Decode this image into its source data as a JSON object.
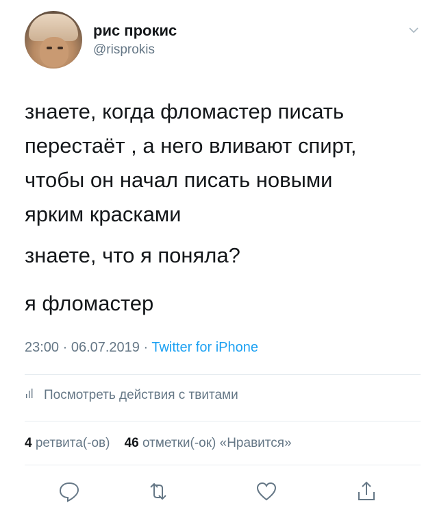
{
  "author": {
    "display_name": "рис прокис",
    "handle": "@risprokis"
  },
  "tweet": {
    "para1_lines": [
      "знаете, когда фломастер писать",
      "перестаёт , а него вливают спирт,",
      "чтобы он начал писать новыми",
      "ярким красками"
    ],
    "para2": "знаете, что я поняла?",
    "para3": "я фломастер"
  },
  "meta": {
    "datetime": "23:00 · 06.07.2019 · ",
    "app": "Twitter for iPhone"
  },
  "activity": {
    "label": "Посмотреть действия с твитами",
    "icon": "bar-chart-icon"
  },
  "stats": {
    "retweets_count": "4",
    "retweets_label": "ретвита(-ов)",
    "likes_count": "46",
    "likes_label": "отметки(-ок) «Нравится»"
  },
  "actions": [
    "reply-icon",
    "retweet-icon",
    "like-icon",
    "share-icon"
  ],
  "colors": {
    "text": "#14171a",
    "secondary": "#657786",
    "accent": "#1da1f2",
    "divider": "#e6ecf0"
  }
}
